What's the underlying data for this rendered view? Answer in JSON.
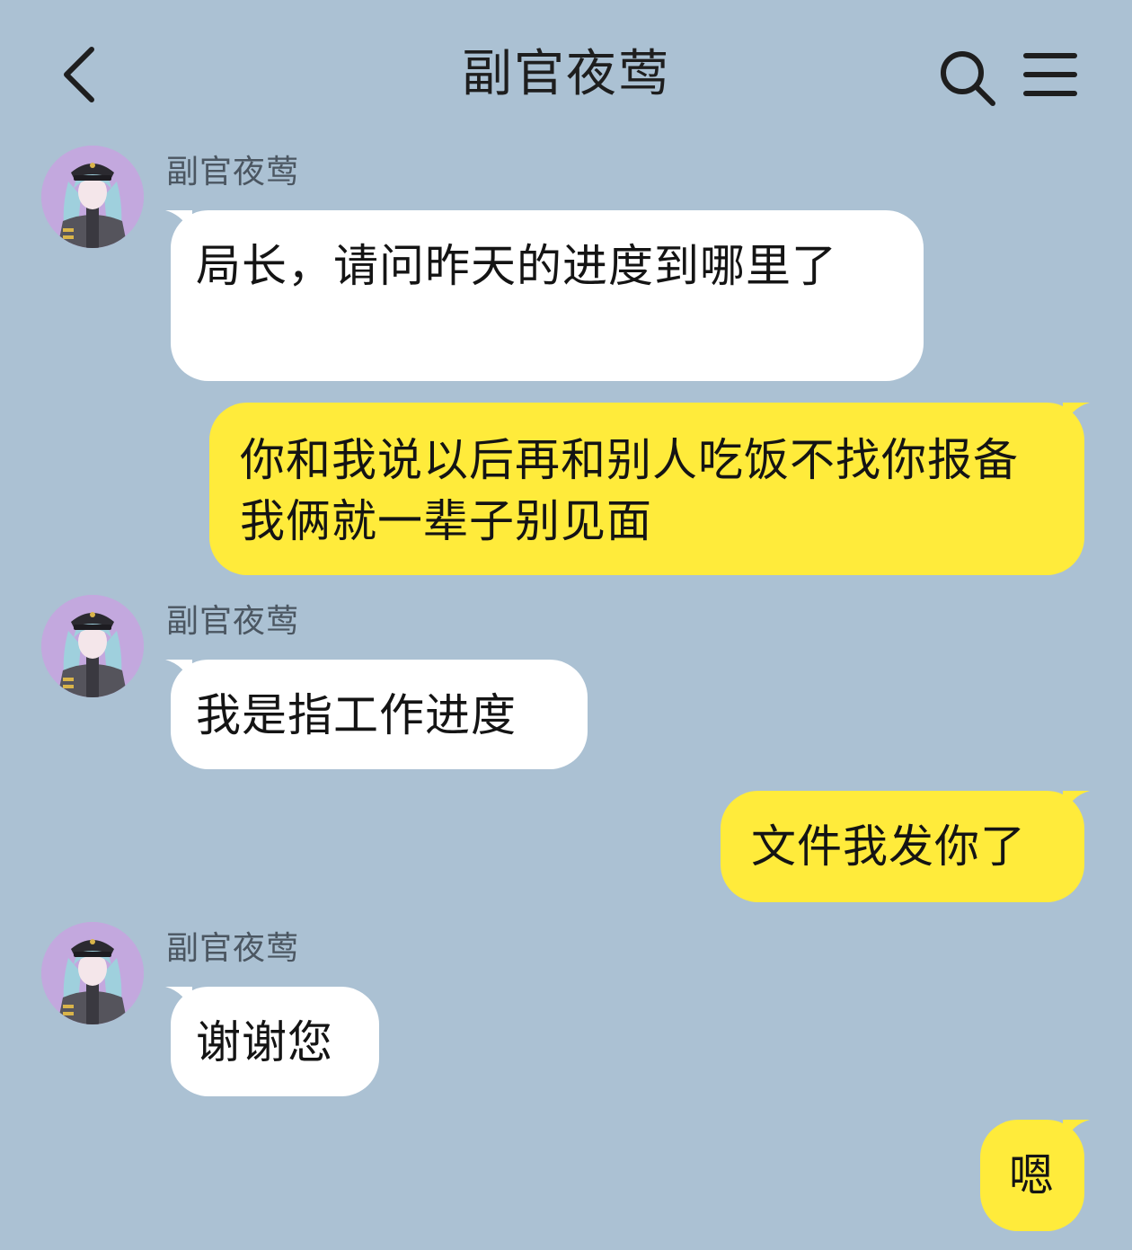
{
  "header": {
    "title": "副官夜莺",
    "back_icon": "chevron-left-icon",
    "search_icon": "search-icon",
    "menu_icon": "menu-icon"
  },
  "colors": {
    "background": "#abc1d3",
    "incoming_bubble": "#ffffff",
    "outgoing_bubble": "#ffeb3b",
    "avatar_background": "#c3a8de"
  },
  "messages": [
    {
      "direction": "incoming",
      "sender": "副官夜莺",
      "text": "局长，请问昨天的进度到哪里了"
    },
    {
      "direction": "outgoing",
      "text": "你和我说以后再和别人吃饭不找你报备我俩就一辈子别见面"
    },
    {
      "direction": "incoming",
      "sender": "副官夜莺",
      "text": "我是指工作进度"
    },
    {
      "direction": "outgoing",
      "text": "文件我发你了"
    },
    {
      "direction": "incoming",
      "sender": "副官夜莺",
      "text": "谢谢您"
    },
    {
      "direction": "outgoing",
      "text": "嗯"
    }
  ]
}
